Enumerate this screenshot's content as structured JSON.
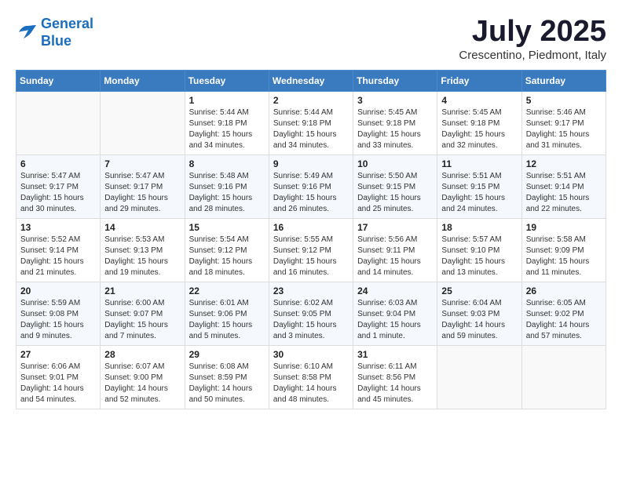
{
  "logo": {
    "line1": "General",
    "line2": "Blue"
  },
  "title": "July 2025",
  "location": "Crescentino, Piedmont, Italy",
  "weekdays": [
    "Sunday",
    "Monday",
    "Tuesday",
    "Wednesday",
    "Thursday",
    "Friday",
    "Saturday"
  ],
  "weeks": [
    [
      {
        "day": "",
        "content": ""
      },
      {
        "day": "",
        "content": ""
      },
      {
        "day": "1",
        "content": "Sunrise: 5:44 AM\nSunset: 9:18 PM\nDaylight: 15 hours and 34 minutes."
      },
      {
        "day": "2",
        "content": "Sunrise: 5:44 AM\nSunset: 9:18 PM\nDaylight: 15 hours and 34 minutes."
      },
      {
        "day": "3",
        "content": "Sunrise: 5:45 AM\nSunset: 9:18 PM\nDaylight: 15 hours and 33 minutes."
      },
      {
        "day": "4",
        "content": "Sunrise: 5:45 AM\nSunset: 9:18 PM\nDaylight: 15 hours and 32 minutes."
      },
      {
        "day": "5",
        "content": "Sunrise: 5:46 AM\nSunset: 9:17 PM\nDaylight: 15 hours and 31 minutes."
      }
    ],
    [
      {
        "day": "6",
        "content": "Sunrise: 5:47 AM\nSunset: 9:17 PM\nDaylight: 15 hours and 30 minutes."
      },
      {
        "day": "7",
        "content": "Sunrise: 5:47 AM\nSunset: 9:17 PM\nDaylight: 15 hours and 29 minutes."
      },
      {
        "day": "8",
        "content": "Sunrise: 5:48 AM\nSunset: 9:16 PM\nDaylight: 15 hours and 28 minutes."
      },
      {
        "day": "9",
        "content": "Sunrise: 5:49 AM\nSunset: 9:16 PM\nDaylight: 15 hours and 26 minutes."
      },
      {
        "day": "10",
        "content": "Sunrise: 5:50 AM\nSunset: 9:15 PM\nDaylight: 15 hours and 25 minutes."
      },
      {
        "day": "11",
        "content": "Sunrise: 5:51 AM\nSunset: 9:15 PM\nDaylight: 15 hours and 24 minutes."
      },
      {
        "day": "12",
        "content": "Sunrise: 5:51 AM\nSunset: 9:14 PM\nDaylight: 15 hours and 22 minutes."
      }
    ],
    [
      {
        "day": "13",
        "content": "Sunrise: 5:52 AM\nSunset: 9:14 PM\nDaylight: 15 hours and 21 minutes."
      },
      {
        "day": "14",
        "content": "Sunrise: 5:53 AM\nSunset: 9:13 PM\nDaylight: 15 hours and 19 minutes."
      },
      {
        "day": "15",
        "content": "Sunrise: 5:54 AM\nSunset: 9:12 PM\nDaylight: 15 hours and 18 minutes."
      },
      {
        "day": "16",
        "content": "Sunrise: 5:55 AM\nSunset: 9:12 PM\nDaylight: 15 hours and 16 minutes."
      },
      {
        "day": "17",
        "content": "Sunrise: 5:56 AM\nSunset: 9:11 PM\nDaylight: 15 hours and 14 minutes."
      },
      {
        "day": "18",
        "content": "Sunrise: 5:57 AM\nSunset: 9:10 PM\nDaylight: 15 hours and 13 minutes."
      },
      {
        "day": "19",
        "content": "Sunrise: 5:58 AM\nSunset: 9:09 PM\nDaylight: 15 hours and 11 minutes."
      }
    ],
    [
      {
        "day": "20",
        "content": "Sunrise: 5:59 AM\nSunset: 9:08 PM\nDaylight: 15 hours and 9 minutes."
      },
      {
        "day": "21",
        "content": "Sunrise: 6:00 AM\nSunset: 9:07 PM\nDaylight: 15 hours and 7 minutes."
      },
      {
        "day": "22",
        "content": "Sunrise: 6:01 AM\nSunset: 9:06 PM\nDaylight: 15 hours and 5 minutes."
      },
      {
        "day": "23",
        "content": "Sunrise: 6:02 AM\nSunset: 9:05 PM\nDaylight: 15 hours and 3 minutes."
      },
      {
        "day": "24",
        "content": "Sunrise: 6:03 AM\nSunset: 9:04 PM\nDaylight: 15 hours and 1 minute."
      },
      {
        "day": "25",
        "content": "Sunrise: 6:04 AM\nSunset: 9:03 PM\nDaylight: 14 hours and 59 minutes."
      },
      {
        "day": "26",
        "content": "Sunrise: 6:05 AM\nSunset: 9:02 PM\nDaylight: 14 hours and 57 minutes."
      }
    ],
    [
      {
        "day": "27",
        "content": "Sunrise: 6:06 AM\nSunset: 9:01 PM\nDaylight: 14 hours and 54 minutes."
      },
      {
        "day": "28",
        "content": "Sunrise: 6:07 AM\nSunset: 9:00 PM\nDaylight: 14 hours and 52 minutes."
      },
      {
        "day": "29",
        "content": "Sunrise: 6:08 AM\nSunset: 8:59 PM\nDaylight: 14 hours and 50 minutes."
      },
      {
        "day": "30",
        "content": "Sunrise: 6:10 AM\nSunset: 8:58 PM\nDaylight: 14 hours and 48 minutes."
      },
      {
        "day": "31",
        "content": "Sunrise: 6:11 AM\nSunset: 8:56 PM\nDaylight: 14 hours and 45 minutes."
      },
      {
        "day": "",
        "content": ""
      },
      {
        "day": "",
        "content": ""
      }
    ]
  ]
}
